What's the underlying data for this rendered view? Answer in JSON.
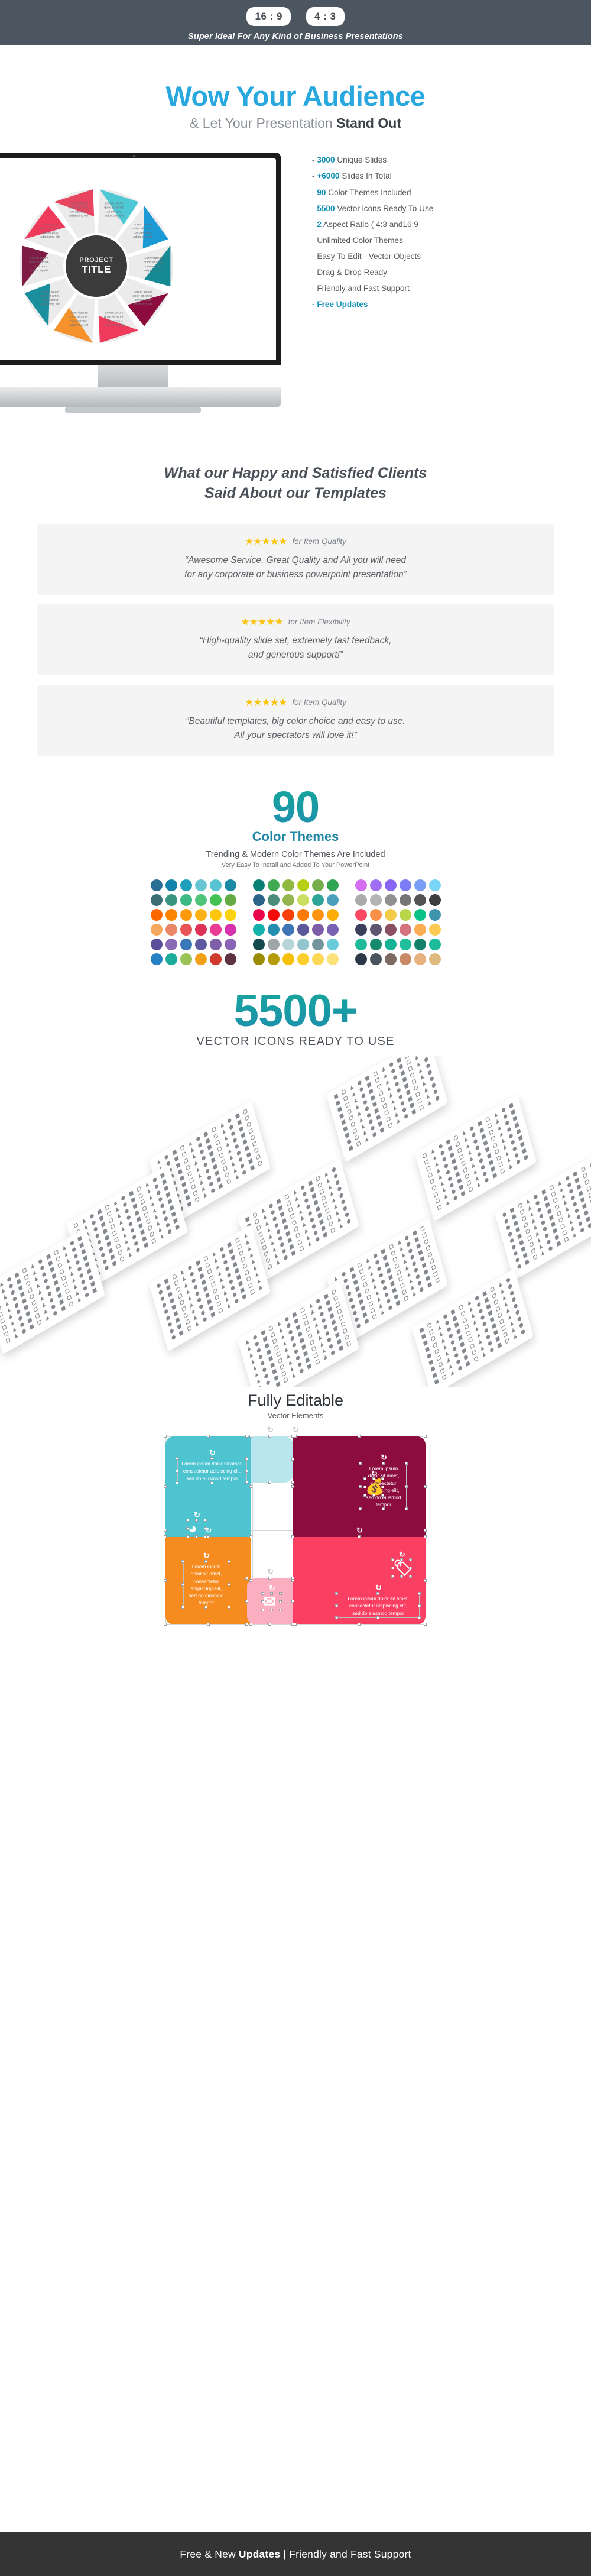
{
  "topbar": {
    "ratios": [
      "16 : 9",
      "4 : 3"
    ],
    "tagline": "Super Ideal For Any Kind of Business Presentations"
  },
  "hero": {
    "title": "Wow Your Audience",
    "subtitle_light": "& Let Your Presentation ",
    "subtitle_bold": "Stand Out",
    "monitor": {
      "wheel_hub_line1": "PROJECT",
      "wheel_hub_line2": "TITLE",
      "segment_text": "Lorem ipsum dolor sit amet, consectetur adipiscing elit",
      "segment_colors": [
        "#4ec8d4",
        "#1b9ad6",
        "#158a94",
        "#8e1b45",
        "#ef3b5b",
        "#f5922b",
        "#1a8f9e",
        "#7e1c45",
        "#ef3b5b",
        "#e8e8e8"
      ]
    },
    "features": [
      {
        "num": "3000",
        "text": " Unique Slides",
        "bold_dash": false
      },
      {
        "num": "+6000",
        "text": " Slides In Total",
        "bold_dash": true
      },
      {
        "num": "90",
        "text": " Color Themes Included",
        "bold_dash": true
      },
      {
        "num": "5500",
        "text": " Vector icons Ready To Use",
        "bold_dash": true
      },
      {
        "num": "2",
        "text": " Aspect Ratio ( 4:3 and16:9",
        "bold_dash": true
      },
      {
        "num": "",
        "text": "Unlimited Color Themes",
        "bold_dash": false
      },
      {
        "num": "",
        "text": "Easy To Edit - Vector Objects",
        "bold_dash": false
      },
      {
        "num": "",
        "text": "Drag & Drop Ready",
        "bold_dash": false
      },
      {
        "num": "",
        "text": "Friendly and Fast Support",
        "bold_dash": false
      },
      {
        "num": "",
        "text": "Free Updates",
        "bold_dash": false,
        "accent": true
      }
    ]
  },
  "testimonials_section": {
    "heading_line1": "What our Happy and Satisfied Clients",
    "heading_line2": "Said About our Templates",
    "items": [
      {
        "stars": "★★★★★",
        "stars_count": 5,
        "for_label": "for Item Quality",
        "quote_line1": "“Awesome Service, Great Quality and All you will need",
        "quote_line2": "for any corporate or business powerpoint presentation”"
      },
      {
        "stars": "★★★★★",
        "stars_count": 5,
        "for_label": "for Item Flexibility",
        "quote_line1": "“High-quality slide set, extremely fast feedback,",
        "quote_line2": "and generous support!”"
      },
      {
        "stars": "★★★★★",
        "stars_count": 5,
        "for_label": "for Item Quality",
        "quote_line1": "“Beautiful templates, big color choice and easy to use.",
        "quote_line2": "All your spectators will love it!”"
      }
    ]
  },
  "themes_section": {
    "number": "90",
    "label": "Color Themes",
    "sub1": "Trending & Modern Color Themes Are Included",
    "sub2": "Very Easy To Install and Added To Your PowerPoint",
    "accent_gradient_from": "#16a59b",
    "accent_gradient_to": "#1e8fae",
    "palette_blocks": [
      [
        [
          "#2a6e94",
          "#1183ab",
          "#1f9ebb",
          "#68c6d2",
          "#55c3d1",
          "#1a8aa3"
        ],
        [
          "#3a6f74",
          "#3b9480",
          "#3cba83",
          "#4fc377",
          "#45c254",
          "#64ab44"
        ],
        [
          "#fb6800",
          "#fd8400",
          "#fd9a0b",
          "#fbb013",
          "#fdc60a",
          "#f9d212"
        ],
        [
          "#f5a85b",
          "#ea8768",
          "#e95457",
          "#dd3158",
          "#e93a94",
          "#d631ac"
        ],
        [
          "#5a4f9a",
          "#8b6cb4",
          "#3b78b8",
          "#5f5aa0",
          "#7e5fa8",
          "#8a63b5"
        ],
        [
          "#2580c4",
          "#1dac9b",
          "#9bc254",
          "#f2a017",
          "#cf3a2c",
          "#5d3340"
        ]
      ],
      [
        [
          "#0a7f74",
          "#3faa52",
          "#8fb943",
          "#b6ce14",
          "#76ad4b",
          "#2fa453"
        ],
        [
          "#2b6289",
          "#4c8d79",
          "#93b44e",
          "#cade62",
          "#2fa597",
          "#4a9fba"
        ],
        [
          "#e9054c",
          "#f10b0b",
          "#fa400a",
          "#fd7a05",
          "#fd9311",
          "#fdad07"
        ],
        [
          "#14b1ab",
          "#248eb0",
          "#4076b5",
          "#5a589b",
          "#7d5ba7",
          "#7a62b3"
        ],
        [
          "#154b4f",
          "#a0a5a8",
          "#b7d5d9",
          "#92c5cd",
          "#74959b",
          "#69cbda"
        ],
        [
          "#9b8a06",
          "#b49b07",
          "#f5c005",
          "#fbce2d",
          "#fdd854",
          "#fce27b"
        ]
      ],
      [
        [
          "#d36ef0",
          "#a06ef0",
          "#8a66f5",
          "#7a7df5",
          "#7a9df5",
          "#7ad4f5"
        ],
        [
          "#aaaaaa",
          "#b4b4b4",
          "#909090",
          "#757575",
          "#525252",
          "#3d3d3d"
        ],
        [
          "#fa4a63",
          "#fa9047",
          "#f0cc48",
          "#b9d64a",
          "#0ac285",
          "#3e93ad"
        ],
        [
          "#3b3e5c",
          "#5f5772",
          "#8b4f62",
          "#d3737f",
          "#fbad53",
          "#fdc953"
        ],
        [
          "#1fb999",
          "#168a6a",
          "#17b295",
          "#1fbf9c",
          "#14806a",
          "#1cbb9b"
        ],
        [
          "#2b3848",
          "#4a545e",
          "#7d6a63",
          "#cb8a67",
          "#e8b180",
          "#ddb97b"
        ]
      ]
    ]
  },
  "vector_icons_section": {
    "number": "5500+",
    "subtitle": "VECTOR ICONS READY TO USE",
    "sheet_count": 11
  },
  "editable_section": {
    "title": "Fully Editable",
    "subtitle": "Vector Elements",
    "blocks": [
      {
        "name": "teal-block",
        "color": "#4fc4d1",
        "icon": "pie-chart-icon",
        "text": "Lorem ipsum dolor sit amet, consectetur adipiscing elit, sed do eiusmod tempor"
      },
      {
        "name": "teal-light-block",
        "color": "#b8e6ec",
        "icon": "",
        "text": ""
      },
      {
        "name": "maroon-block",
        "color": "#8d0c3e",
        "icon": "money-bag-icon",
        "text": "Lorem ipsum dolor sit amet, consectetur adipiscing elit, sed do eiusmod tempor"
      },
      {
        "name": "orange-peach-block",
        "color": "#fbc08a",
        "icon": "",
        "text": ""
      },
      {
        "name": "orange-block",
        "color": "#f68b1f",
        "icon": "mail-icon",
        "text": "Lorem ipsum dolor sit amet, consectetur adipiscing elit, sed do eiusmod tempor"
      },
      {
        "name": "mauve-block",
        "color": "#c08098",
        "icon": "",
        "text": ""
      },
      {
        "name": "pink-block",
        "color": "#fa3f63",
        "icon": "price-tag-icon",
        "text": "Lorem ipsum dolor sit amet, consectetur adipiscing elit, sed do eiusmod tempor"
      },
      {
        "name": "pink-light-block",
        "color": "#fbaec0",
        "icon": "",
        "text": ""
      }
    ],
    "rotate_icon": "↻"
  },
  "footer": {
    "text_part1": "Free & New ",
    "text_bold": "Updates",
    "text_part2": " | Friendly and Fast Support"
  }
}
